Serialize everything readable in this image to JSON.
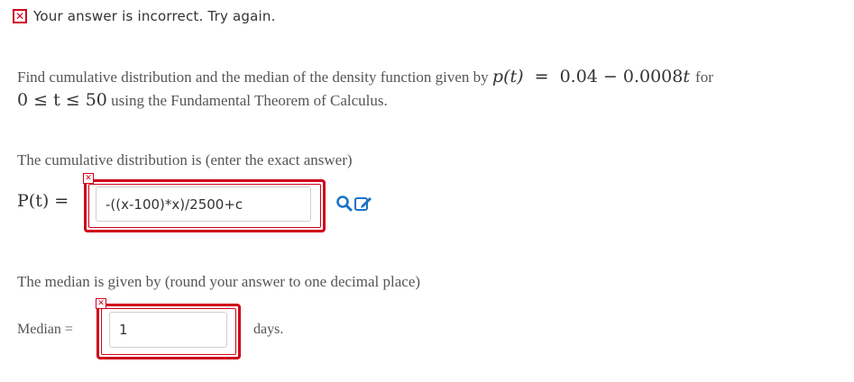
{
  "feedback": {
    "icon": "x-mark-icon",
    "text": "Your answer is incorrect.  Try again."
  },
  "problem": {
    "line1_prefix": "Find cumulative distribution and the median of the density function given by",
    "p_t": "p(t)",
    "equals": "=",
    "formula": "0.04 − 0.0008",
    "formula_var": "t",
    "line1_suffix": "for",
    "range": "0 ≤ t ≤ 50",
    "line2_suffix": "using the Fundamental Theorem of Calculus."
  },
  "cdf": {
    "prompt": "The cumulative distribution is (enter the exact answer)",
    "label": "P(t) =",
    "value": "-((x-100)*x)/2500+c",
    "status": "incorrect",
    "tools": [
      "preview-icon",
      "edit-icon"
    ]
  },
  "median": {
    "prompt": "The median is given by (round your answer to one decimal place)",
    "label": "Median =",
    "value": "1",
    "unit": "days.",
    "status": "incorrect"
  },
  "colors": {
    "error": "#d0021b",
    "tool": "#1a73c8",
    "text": "#555555"
  }
}
